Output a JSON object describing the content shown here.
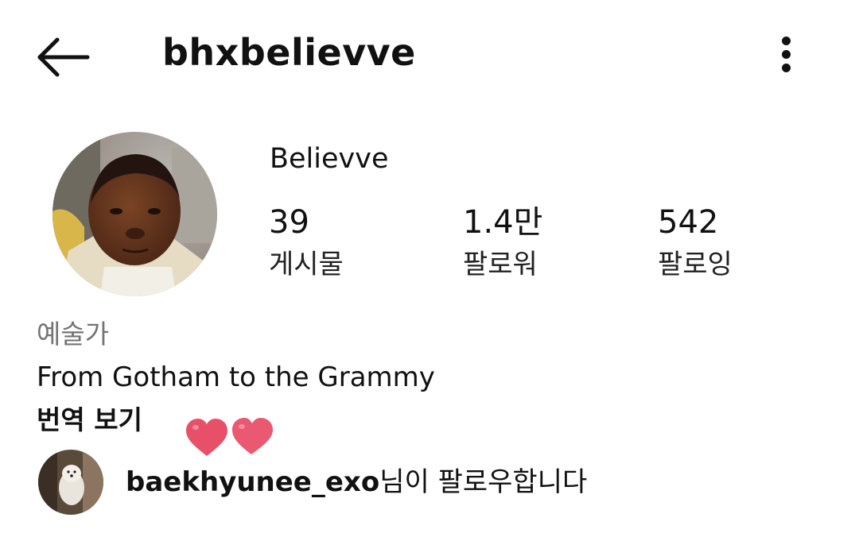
{
  "header": {
    "username": "bhxbelievve",
    "back_icon": "arrow-left-icon",
    "more_icon": "more-vertical-icon"
  },
  "profile": {
    "display_name": "Believve",
    "stats": {
      "posts": {
        "count": "39",
        "label": "게시물"
      },
      "followers": {
        "count": "1.4만",
        "label": "팔로워"
      },
      "following": {
        "count": "542",
        "label": "팔로잉"
      }
    },
    "category": "예술가",
    "bio": "From Gotham to the Grammy",
    "translate_label": "번역 보기",
    "followed_by": {
      "username": "baekhyunee_exo",
      "suffix": "님이 팔로우합니다"
    }
  },
  "colors": {
    "text": "#111111",
    "secondary_text": "#737373",
    "heart": "#e8506a"
  }
}
